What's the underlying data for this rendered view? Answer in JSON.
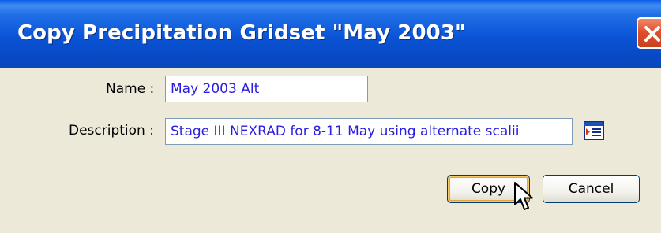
{
  "window": {
    "title": "Copy Precipitation Gridset \"May 2003\""
  },
  "form": {
    "name_label": "Name :",
    "name_value": "May 2003 Alt",
    "description_label": "Description :",
    "description_value": "Stage III NEXRAD for 8-11 May using alternate scalii"
  },
  "buttons": {
    "copy": "Copy",
    "cancel": "Cancel"
  },
  "icons": {
    "close": "close-icon",
    "edit_description": "edit-text-icon",
    "cursor": "mouse-pointer-icon"
  },
  "colors": {
    "title_bar": "#0a54d6",
    "field_text": "#2a1ee0",
    "dialog_bg": "#ece9d8",
    "close_button": "#e0502a"
  }
}
